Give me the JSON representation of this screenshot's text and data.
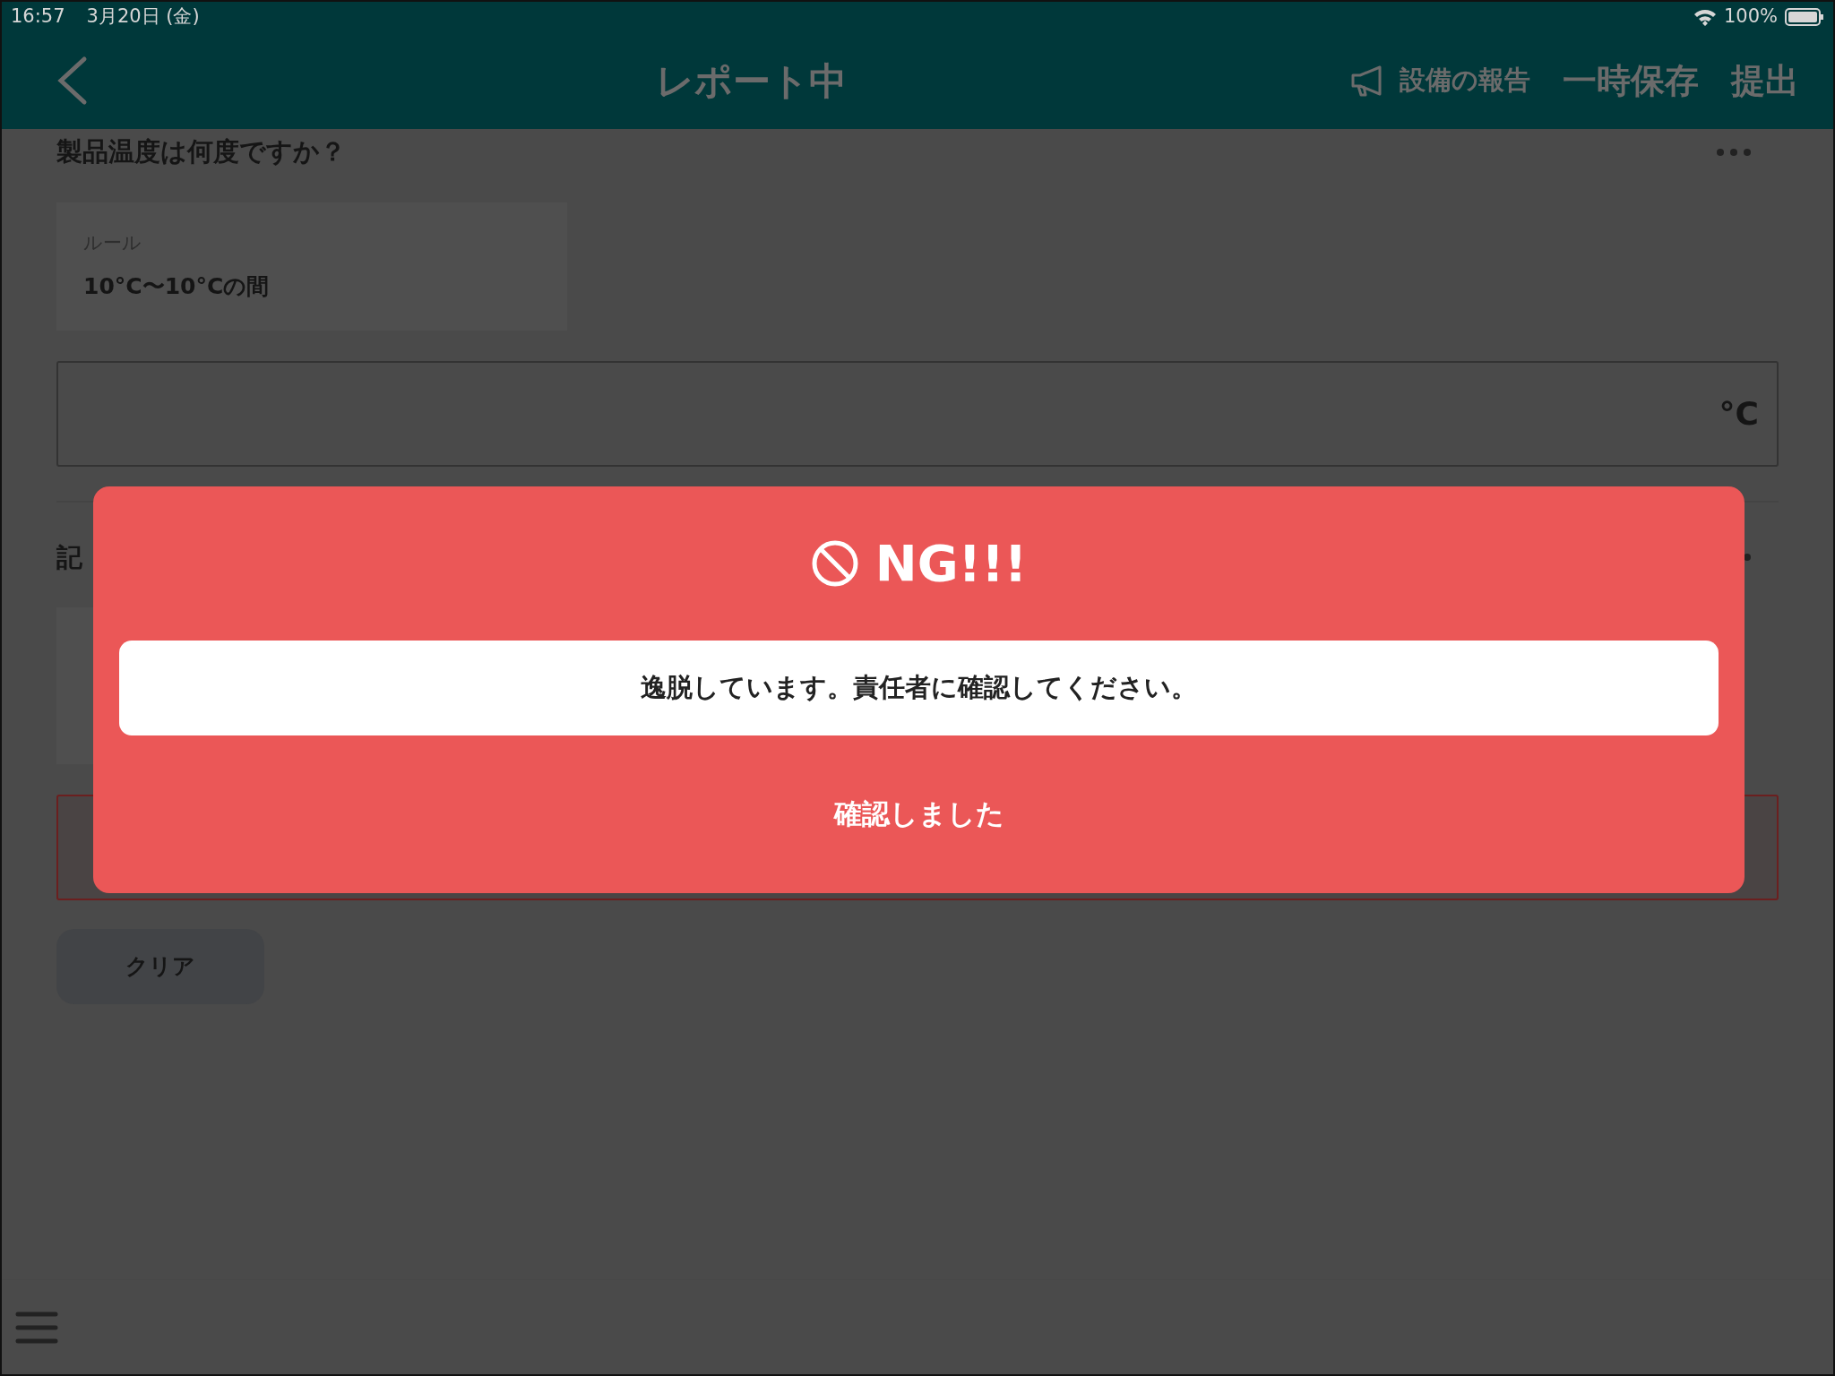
{
  "status_bar": {
    "time": "16:57",
    "date": "3月20日 (金)",
    "battery": "100%"
  },
  "header": {
    "title": "レポート中",
    "actions": [
      {
        "label": "設備の報告",
        "kind": "report"
      },
      {
        "label": "一時保存",
        "kind": "plain"
      },
      {
        "label": "提出",
        "kind": "plain"
      }
    ]
  },
  "questions": [
    {
      "title": "製品温度は何度ですか？",
      "rule": {
        "label": "ルール",
        "value": "10°C〜10°Cの間"
      },
      "field": {
        "unit": "°C",
        "invalid": false
      }
    },
    {
      "title": "記",
      "field": {
        "invalid": true
      }
    }
  ],
  "clear_button": {
    "label": "クリア"
  },
  "dialog": {
    "title": "NG!!!",
    "message": "逸脱しています。責任者に確認してください。",
    "confirm": "確認しました"
  }
}
